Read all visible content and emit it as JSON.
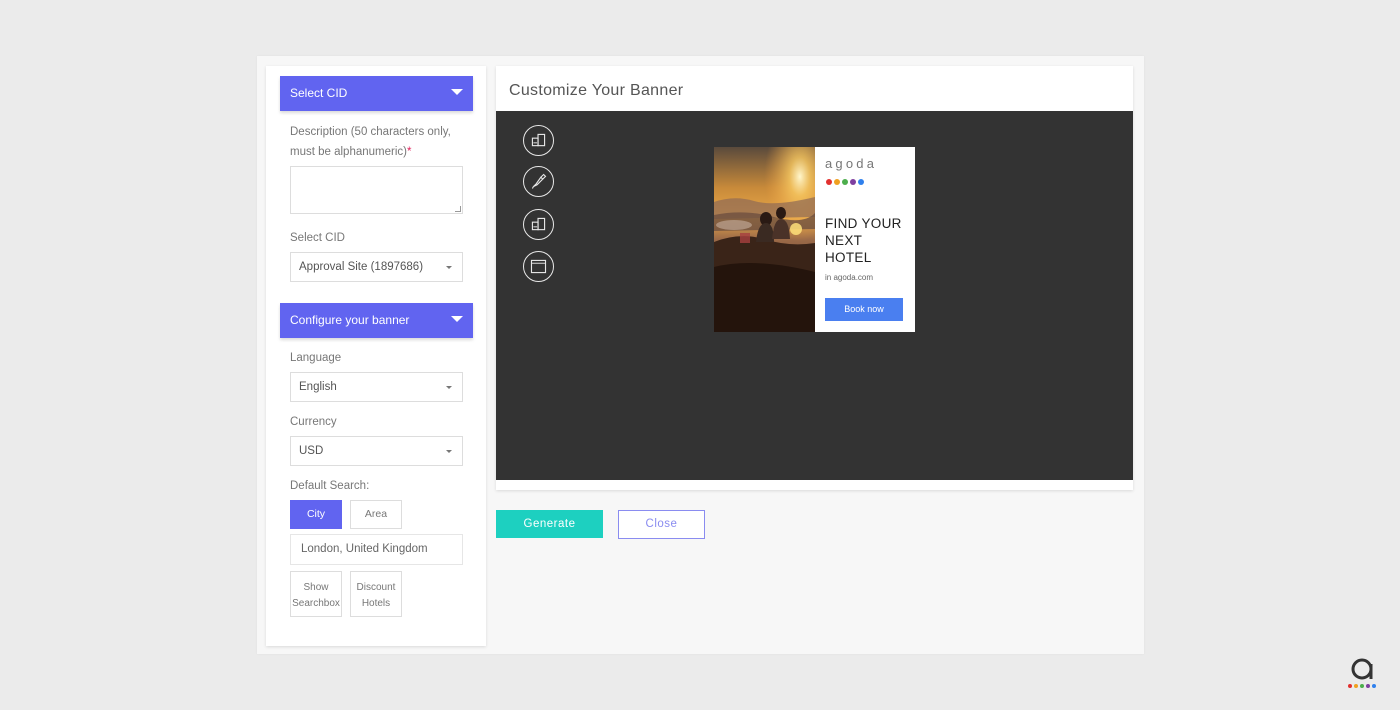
{
  "left_panel": {
    "select_cid_header": "Select CID",
    "description_label": "Description (50 characters only, must be alphanumeric)",
    "description_required_mark": "*",
    "description_value": "",
    "select_cid_label": "Select CID",
    "select_cid_value": "Approval Site (1897686)",
    "configure_header": "Configure your banner",
    "language_label": "Language",
    "language_value": "English",
    "currency_label": "Currency",
    "currency_value": "USD",
    "default_search_label": "Default Search:",
    "toggle_city": "City",
    "toggle_area": "Area",
    "location_value": "London, United Kingdom",
    "option_show_searchbox_line1": "Show",
    "option_show_searchbox_line2": "Searchbox",
    "option_discount_line1": "Discount",
    "option_discount_line2": "Hotels"
  },
  "card": {
    "title": "Customize Your Banner",
    "tools": [
      "layout-icon",
      "brush-icon",
      "layout-icon",
      "resize-icon"
    ]
  },
  "banner": {
    "logo_text": "agoda",
    "logo_dot_colors": [
      "#e2302f",
      "#f0a020",
      "#4cae4c",
      "#7e3fa0",
      "#2f80ed"
    ],
    "headline": "FIND YOUR NEXT HOTEL",
    "subline": "in agoda.com",
    "cta": "Book now"
  },
  "actions": {
    "generate": "Generate",
    "close": "Close"
  },
  "colors": {
    "accent": "#6164f0",
    "generate": "#1dd0c0",
    "cta": "#4a7ff0",
    "preview_bg": "#333333"
  }
}
